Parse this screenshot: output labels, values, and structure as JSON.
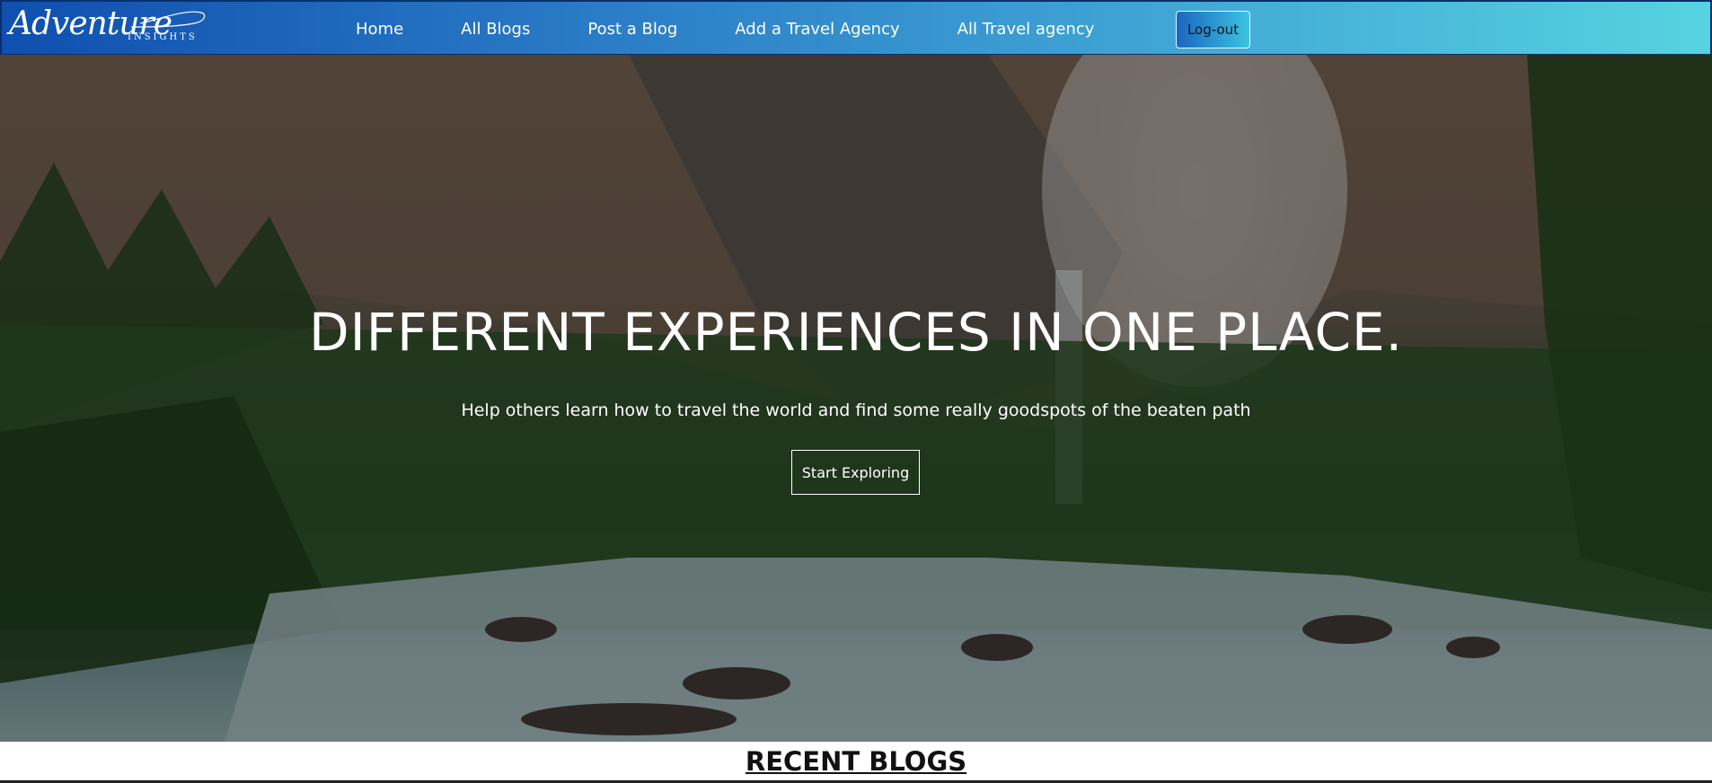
{
  "brand": {
    "logo_word": "Adventure",
    "logo_sub": "INSIGHTS"
  },
  "nav": {
    "items": [
      {
        "label": "Home"
      },
      {
        "label": "All Blogs"
      },
      {
        "label": "Post a Blog"
      },
      {
        "label": "Add a Travel Agency"
      },
      {
        "label": "All Travel agency"
      }
    ],
    "logout_label": "Log-out"
  },
  "hero": {
    "title": "DIFFERENT EXPERIENCES IN ONE PLACE.",
    "subtitle": "Help others learn how to travel the world and find some really goodspots of the beaten path",
    "cta_label": "Start Exploring"
  },
  "sections": {
    "recent_blogs_title": "RECENT BLOGS"
  },
  "colors": {
    "nav_gradient_start": "#0f4fb0",
    "nav_gradient_end": "#56d3e0",
    "hero_text": "#ffffff"
  }
}
